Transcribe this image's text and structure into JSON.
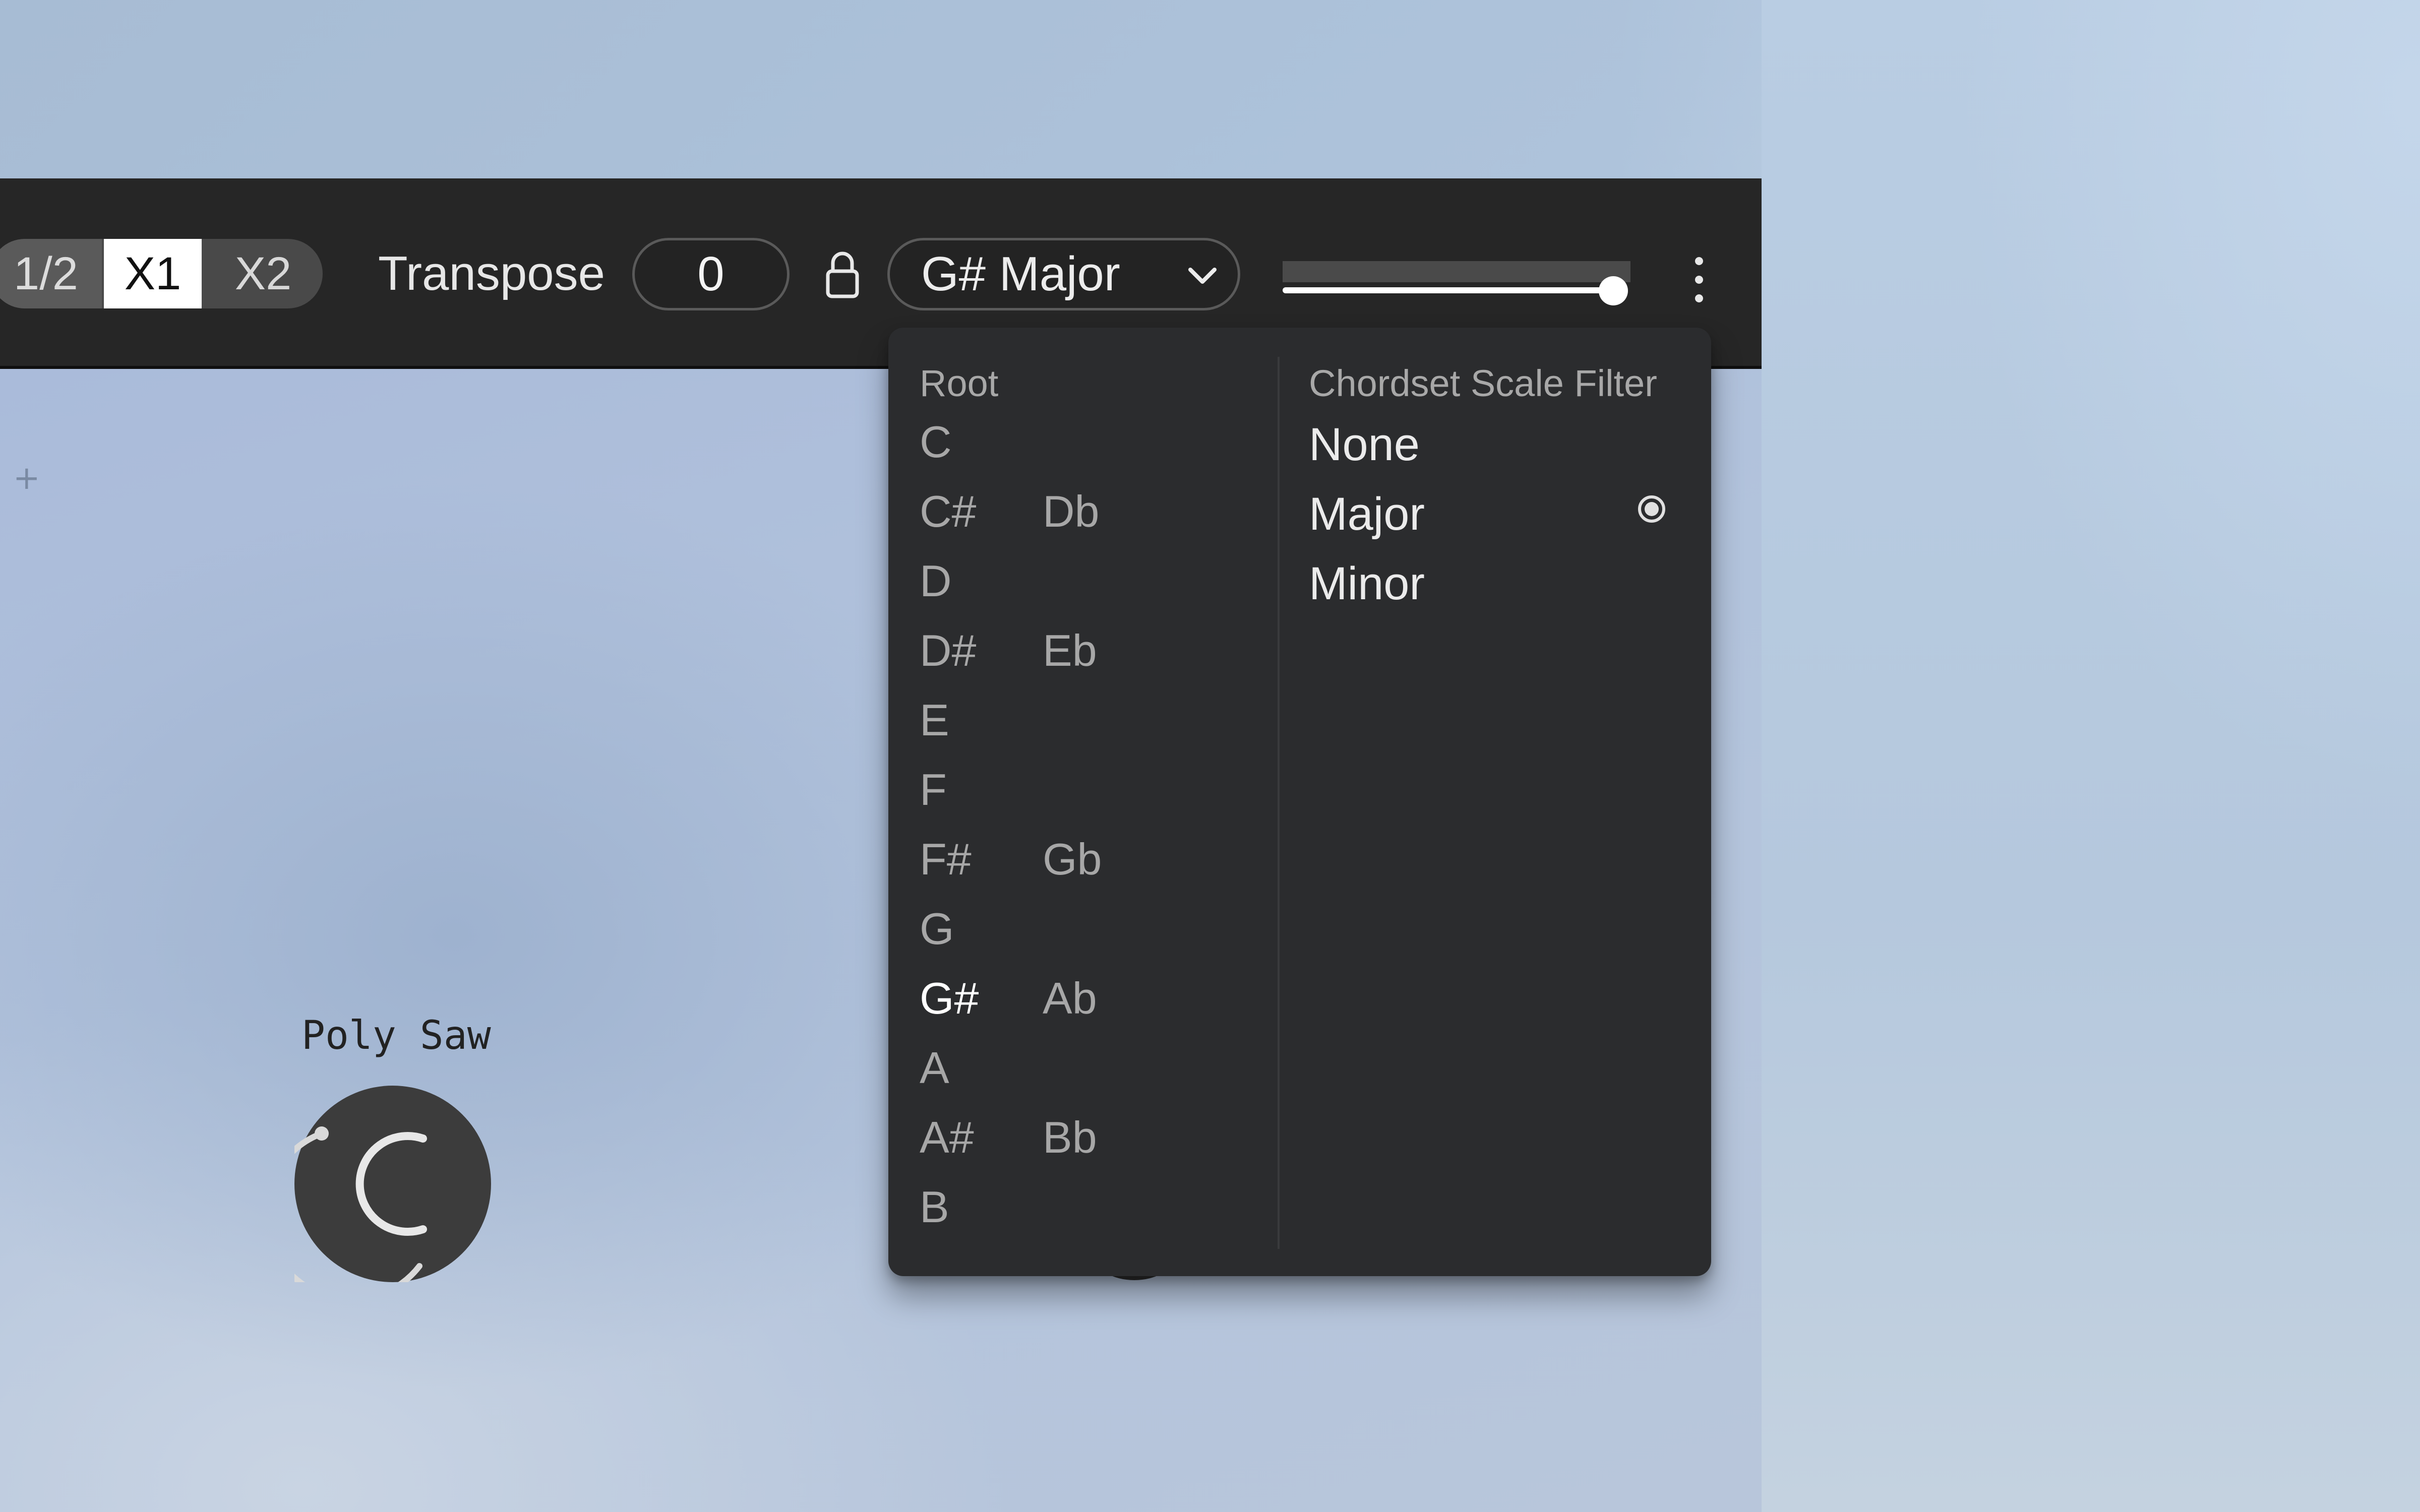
{
  "toolbar": {
    "rate_options": [
      "1/2",
      "X1",
      "X2"
    ],
    "rate_selected": "X1",
    "transpose_label": "Transpose",
    "transpose_value": "0",
    "key_value": "G# Major",
    "volume_level": 0.95
  },
  "dropdown": {
    "root_heading": "Root",
    "roots": [
      {
        "sharp": "C",
        "flat": ""
      },
      {
        "sharp": "C#",
        "flat": "Db"
      },
      {
        "sharp": "D",
        "flat": ""
      },
      {
        "sharp": "D#",
        "flat": "Eb"
      },
      {
        "sharp": "E",
        "flat": ""
      },
      {
        "sharp": "F",
        "flat": ""
      },
      {
        "sharp": "F#",
        "flat": "Gb"
      },
      {
        "sharp": "G",
        "flat": ""
      },
      {
        "sharp": "G#",
        "flat": "Ab"
      },
      {
        "sharp": "A",
        "flat": ""
      },
      {
        "sharp": "A#",
        "flat": "Bb"
      },
      {
        "sharp": "B",
        "flat": ""
      }
    ],
    "selected_root": "G#",
    "scale_heading": "Chordset Scale Filter",
    "scale_options": [
      "None",
      "Major",
      "Minor"
    ],
    "selected_scale": "Major"
  },
  "device": {
    "label": "Poly Saw"
  },
  "icons": {
    "lock": "lock-icon",
    "chevron": "chevron-down-icon",
    "more": "more-vertical-icon",
    "plus": "plus-icon",
    "radio": "radio-selected-icon"
  },
  "colors": {
    "toolbar_bg": "#262626",
    "dropdown_bg": "#2b2c2e",
    "active_text": "#ffffff",
    "inactive_text": "#a7a7a7"
  }
}
